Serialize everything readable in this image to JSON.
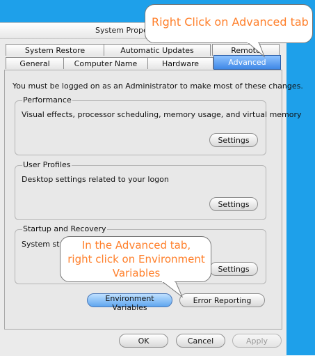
{
  "window": {
    "title": "System Proper"
  },
  "tabs": {
    "row1": [
      "System Restore",
      "Automatic Updates",
      "Remote"
    ],
    "row2": [
      "General",
      "Computer Name",
      "Hardware",
      "Advanced"
    ]
  },
  "advanced": {
    "admin_note": "You must be logged on as an Administrator to make most of these changes.",
    "performance": {
      "label": "Performance",
      "desc": "Visual effects, processor scheduling, memory usage, and virtual memory",
      "button": "Settings"
    },
    "user_profiles": {
      "label": "User Profiles",
      "desc": "Desktop settings related to your logon",
      "button": "Settings"
    },
    "startup": {
      "label": "Startup and Recovery",
      "desc": "System start",
      "button": "Settings"
    },
    "env_button": "Environment Variables",
    "error_button": "Error Reporting"
  },
  "footer": {
    "ok": "OK",
    "cancel": "Cancel",
    "apply": "Apply"
  },
  "callouts": {
    "top": "Right Click on Advanced tab",
    "mid": [
      "In the Advanced tab,",
      "right click on Environment",
      "Variables"
    ]
  },
  "colors": {
    "desktop": "#1ea0ea",
    "callout_text": "#ff7f2a",
    "active_tab": "#3f88e7"
  }
}
